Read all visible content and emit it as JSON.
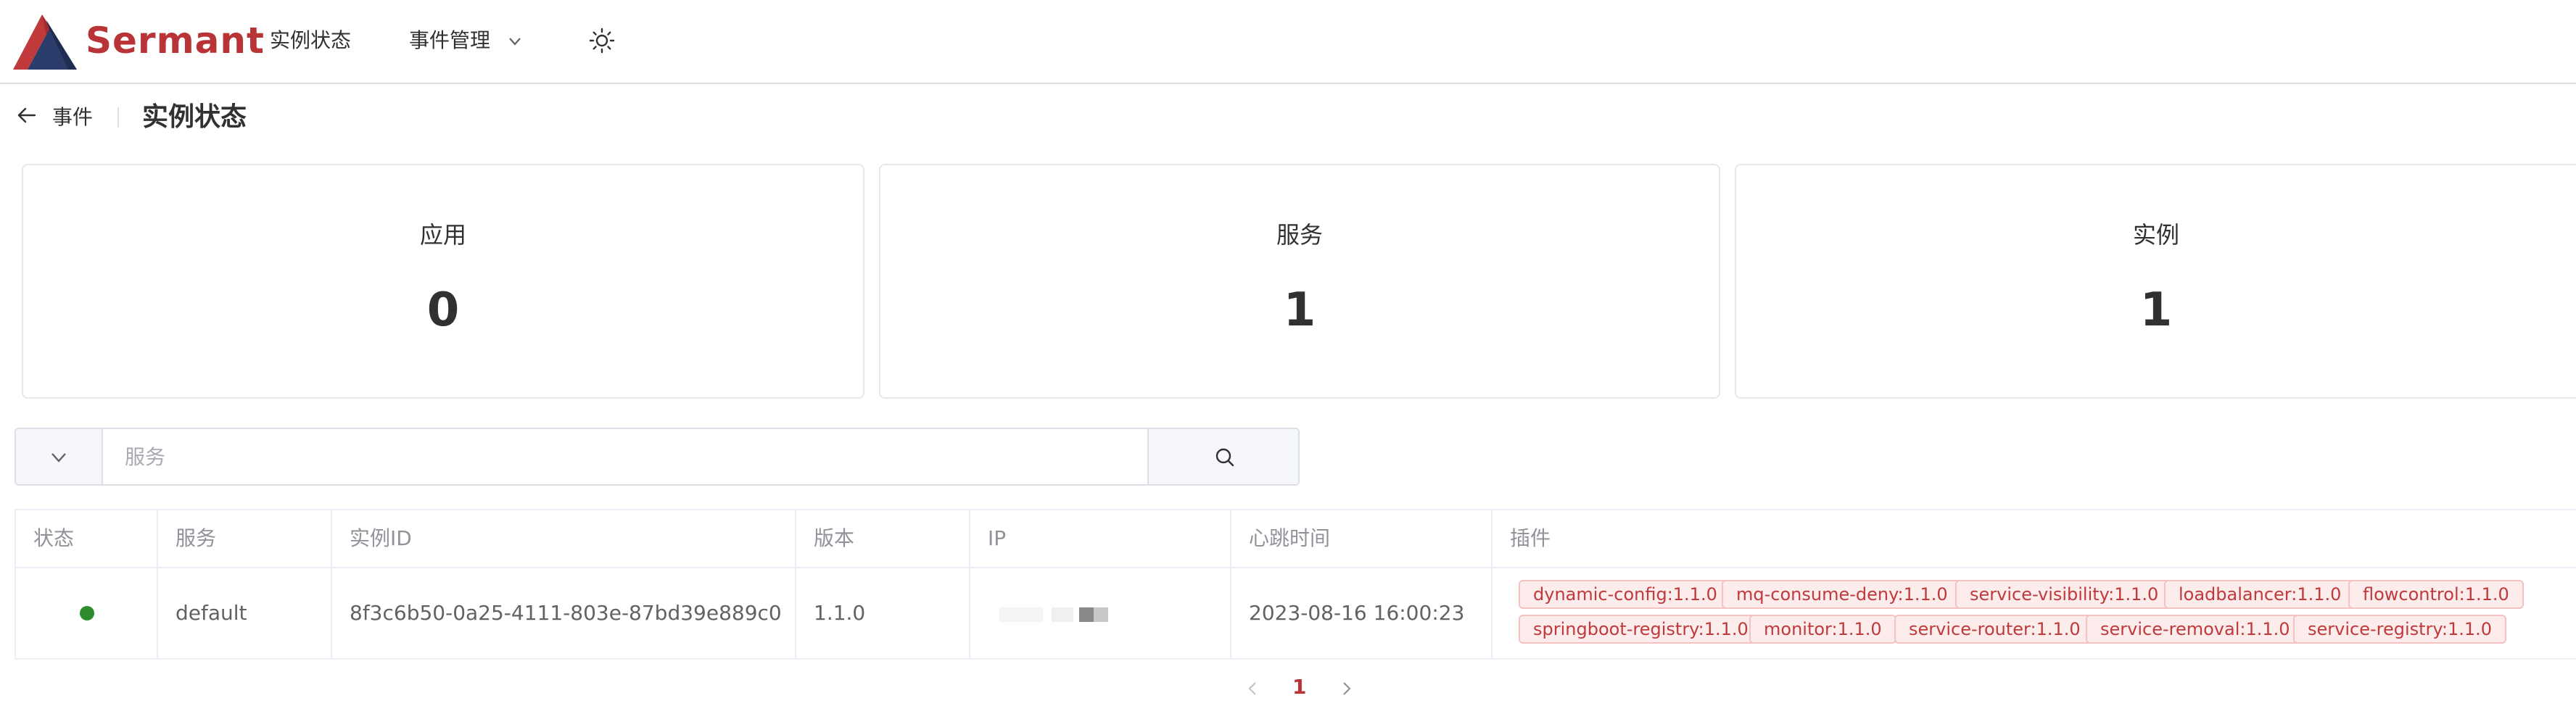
{
  "header": {
    "brand": "Sermant",
    "nav": [
      {
        "label": "实例状态"
      },
      {
        "label": "事件管理"
      }
    ]
  },
  "page": {
    "back_label": "事件",
    "title": "实例状态"
  },
  "stats": [
    {
      "label": "应用",
      "value": "0"
    },
    {
      "label": "服务",
      "value": "1"
    },
    {
      "label": "实例",
      "value": "1"
    }
  ],
  "search": {
    "placeholder": "服务",
    "value": ""
  },
  "table": {
    "columns": [
      "状态",
      "服务",
      "实例ID",
      "版本",
      "IP",
      "心跳时间",
      "插件"
    ],
    "rows": [
      {
        "status": "online",
        "service": "default",
        "instance_id": "8f3c6b50-0a25-4111-803e-87bd39e889c0",
        "version": "1.1.0",
        "ip": "",
        "heartbeat": "2023-08-16 16:00:23",
        "plugins": [
          "dynamic-config:1.1.0",
          "mq-consume-deny:1.1.0",
          "service-visibility:1.1.0",
          "loadbalancer:1.1.0",
          "flowcontrol:1.1.0",
          "springboot-registry:1.1.0",
          "monitor:1.1.0",
          "service-router:1.1.0",
          "service-removal:1.1.0",
          "service-registry:1.1.0"
        ]
      }
    ]
  },
  "pagination": {
    "current": "1"
  },
  "colors": {
    "brand": "#b83437",
    "status_online": "#2e8b2e",
    "tag_text": "#c0393b",
    "tag_bg": "#fdecec"
  },
  "icons": [
    "sermant-logo",
    "chevron-down-icon",
    "sun-icon",
    "arrow-left-icon",
    "search-icon",
    "chevron-left-icon",
    "chevron-right-icon"
  ]
}
